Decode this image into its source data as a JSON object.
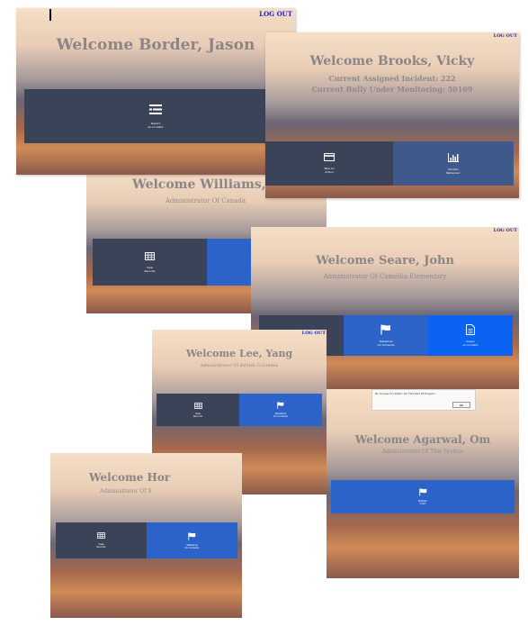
{
  "logout_label": "LOG OUT",
  "screens": {
    "border": {
      "title": "Welcome Border, Jason",
      "tiles": [
        {
          "label": "Report\nAn Incident",
          "icon": "list-icon"
        }
      ]
    },
    "brooks": {
      "title": "Welcome Brooks, Vicky",
      "line1": "Current Assigned Incident: 222",
      "line2": "Current Bully Under Monitoring: 50109",
      "tiles": [
        {
          "label": "Take An\nAction",
          "icon": "card-icon"
        },
        {
          "label": "Monitor\nBehaviour",
          "icon": "bar-chart-icon"
        }
      ]
    },
    "williams": {
      "title": "Welcome Williams, Ma",
      "subtitle": "Administrator Of Canada",
      "tiles": [
        {
          "label": "View\nRecords",
          "icon": "table-icon"
        },
        {
          "label": "",
          "icon": ""
        }
      ]
    },
    "seare": {
      "title": "Welcome Seare, John",
      "subtitle": "Administrator Of Camellia Elementary",
      "tiles": [
        {
          "label": "",
          "icon": ""
        },
        {
          "label": "Statistical\nOn Incidents",
          "icon": "flag-icon"
        },
        {
          "label": "Assign\nAn Incident",
          "icon": "document-icon"
        }
      ]
    },
    "lee": {
      "title": "Welcome Lee, Yang",
      "subtitle": "Administrator Of British Columbia",
      "tiles": [
        {
          "label": "View\nRecords",
          "icon": "table-icon"
        },
        {
          "label": "Statistical\nOn Incidents",
          "icon": "flag-icon"
        }
      ]
    },
    "agarwal": {
      "title": "Welcome Agarwal, Om",
      "subtitle": "Administrator Of This System",
      "dialog_text": "No Access For Public On This Part Of Project!",
      "dialog_ok": "OK",
      "tiles": [
        {
          "label": "Statistic\nChart",
          "icon": "flag-icon"
        }
      ]
    },
    "hor": {
      "title": "Welcome Hor",
      "subtitle": "Administrator Of S",
      "tiles": [
        {
          "label": "View\nRecords",
          "icon": "table-icon"
        },
        {
          "label": "Statistical\nOn Incidents",
          "icon": "flag-icon"
        }
      ]
    }
  }
}
